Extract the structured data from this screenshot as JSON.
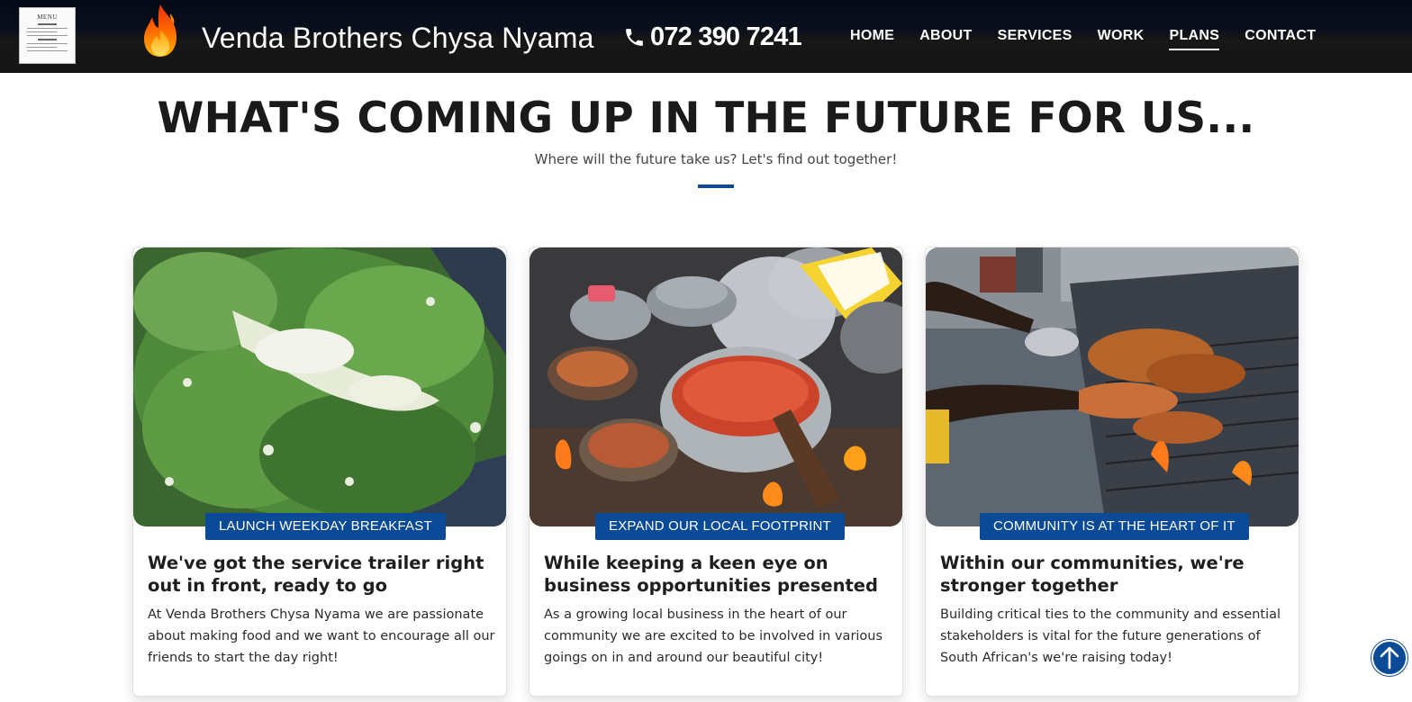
{
  "header": {
    "menu_thumbnail": {
      "title": "MENU",
      "icon": "menu-board-thumbnail"
    },
    "logo_icon": "flame-icon",
    "brand": "Venda Brothers Chysa Nyama",
    "phone": {
      "icon": "phone-icon",
      "number": "072 390 7241"
    },
    "nav": [
      {
        "label": "HOME",
        "active": false
      },
      {
        "label": "ABOUT",
        "active": false
      },
      {
        "label": "SERVICES",
        "active": false
      },
      {
        "label": "WORK",
        "active": false
      },
      {
        "label": "PLANS",
        "active": true
      },
      {
        "label": "CONTACT",
        "active": false
      }
    ]
  },
  "section": {
    "title": "WHAT'S COMING UP IN THE FUTURE FOR US...",
    "subtitle": "Where will the future take us? Let's find out together!"
  },
  "cards": [
    {
      "image": "chopped-spinach-and-onions-photo",
      "badge": "LAUNCH WEEKDAY BREAKFAST",
      "title": "We've got the service trailer right out in front, ready to go",
      "text": "At Venda Brothers Chysa Nyama we are passionate about making food and we want to encourage all our friends to start the day right!"
    },
    {
      "image": "potjie-pots-on-fire-photo",
      "badge": "EXPAND OUR LOCAL FOOTPRINT",
      "title": "While keeping a keen eye on business opportunities presented",
      "text": "As a growing local business in the heart of our community we are excited to be involved in various goings on in and around our beautiful city!"
    },
    {
      "image": "braai-grill-meat-photo",
      "badge": "COMMUNITY IS AT THE HEART OF IT",
      "title": "Within our communities, we're stronger together",
      "text": "Building critical ties to the community and essential stakeholders is vital for the future generations of South African's we're raising today!"
    }
  ],
  "back_to_top": {
    "icon": "arrow-up-icon"
  },
  "colors": {
    "accent": "#0b4a97",
    "header_bg": "#151515",
    "heading_text": "#1a1a1a"
  }
}
